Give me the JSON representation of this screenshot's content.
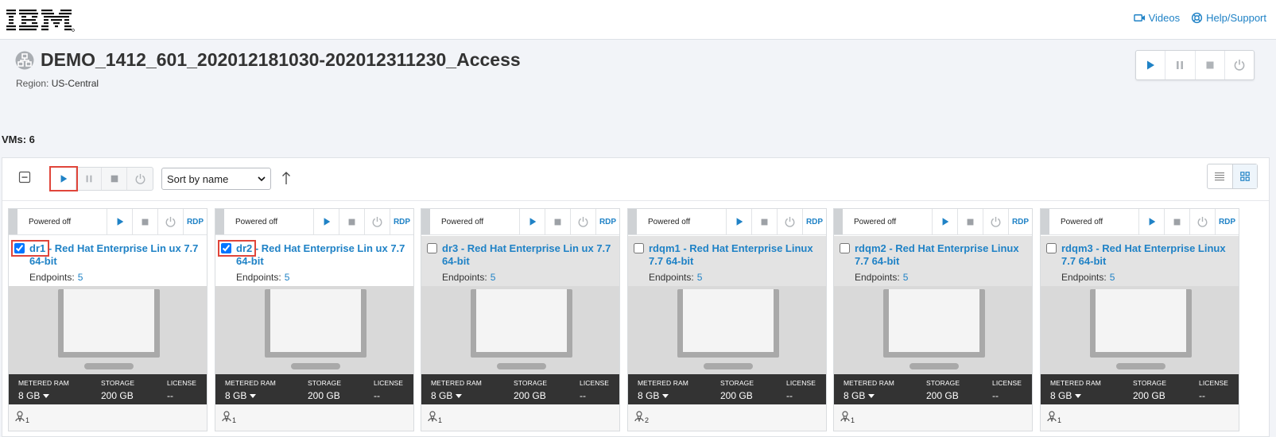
{
  "header": {
    "logo_text": "IBM",
    "links": [
      {
        "label": "Videos",
        "icon": "video-icon"
      },
      {
        "label": "Help/Support",
        "icon": "help-lifebuoy-icon"
      }
    ]
  },
  "environment": {
    "title": "DEMO_1412_601_202012181030-202012311230_Access",
    "region_label": "Region:",
    "region_value": "US-Central"
  },
  "vm_count": "VMs: 6",
  "toolbar": {
    "sort_selected": "Sort by name",
    "sort_options": [
      "Sort by name"
    ]
  },
  "colors": {
    "accent": "#1f82c6",
    "highlight": "#e0453a",
    "stats_bar": "#333333"
  },
  "cards": [
    {
      "status": "Powered off",
      "rdp": "RDP",
      "checked": true,
      "name_id": "dr1",
      "name_rest": " - Red Hat Enterprise Lin ux 7.7 64-bit",
      "endpoints_label": "Endpoints:",
      "endpoints": "5",
      "ram_label": "METERED RAM",
      "ram": "8 GB",
      "storage_label": "STORAGE",
      "storage": "200 GB",
      "license_label": "LICENSE",
      "license": "--",
      "users": "1"
    },
    {
      "status": "Powered off",
      "rdp": "RDP",
      "checked": true,
      "name_id": "dr2",
      "name_rest": " - Red Hat Enterprise Lin ux 7.7 64-bit",
      "endpoints_label": "Endpoints:",
      "endpoints": "5",
      "ram_label": "METERED RAM",
      "ram": "8 GB",
      "storage_label": "STORAGE",
      "storage": "200 GB",
      "license_label": "LICENSE",
      "license": "--",
      "users": "1"
    },
    {
      "status": "Powered off",
      "rdp": "RDP",
      "checked": false,
      "name_id": "dr3",
      "name_rest": " - Red Hat Enterprise Lin ux 7.7 64-bit",
      "endpoints_label": "Endpoints:",
      "endpoints": "5",
      "ram_label": "METERED RAM",
      "ram": "8 GB",
      "storage_label": "STORAGE",
      "storage": "200 GB",
      "license_label": "LICENSE",
      "license": "--",
      "users": "1"
    },
    {
      "status": "Powered off",
      "rdp": "RDP",
      "checked": false,
      "name_id": "rdqm1",
      "name_rest": " - Red Hat Enterprise Linux 7.7 64-bit",
      "endpoints_label": "Endpoints:",
      "endpoints": "5",
      "ram_label": "METERED RAM",
      "ram": "8 GB",
      "storage_label": "STORAGE",
      "storage": "200 GB",
      "license_label": "LICENSE",
      "license": "--",
      "users": "2"
    },
    {
      "status": "Powered off",
      "rdp": "RDP",
      "checked": false,
      "name_id": "rdqm2",
      "name_rest": " - Red Hat Enterprise Linux 7.7 64-bit",
      "endpoints_label": "Endpoints:",
      "endpoints": "5",
      "ram_label": "METERED RAM",
      "ram": "8 GB",
      "storage_label": "STORAGE",
      "storage": "200 GB",
      "license_label": "LICENSE",
      "license": "--",
      "users": "1"
    },
    {
      "status": "Powered off",
      "rdp": "RDP",
      "checked": false,
      "name_id": "rdqm3",
      "name_rest": " - Red Hat Enterprise Linux 7.7 64-bit",
      "endpoints_label": "Endpoints:",
      "endpoints": "5",
      "ram_label": "METERED RAM",
      "ram": "8 GB",
      "storage_label": "STORAGE",
      "storage": "200 GB",
      "license_label": "LICENSE",
      "license": "--",
      "users": "1"
    }
  ]
}
